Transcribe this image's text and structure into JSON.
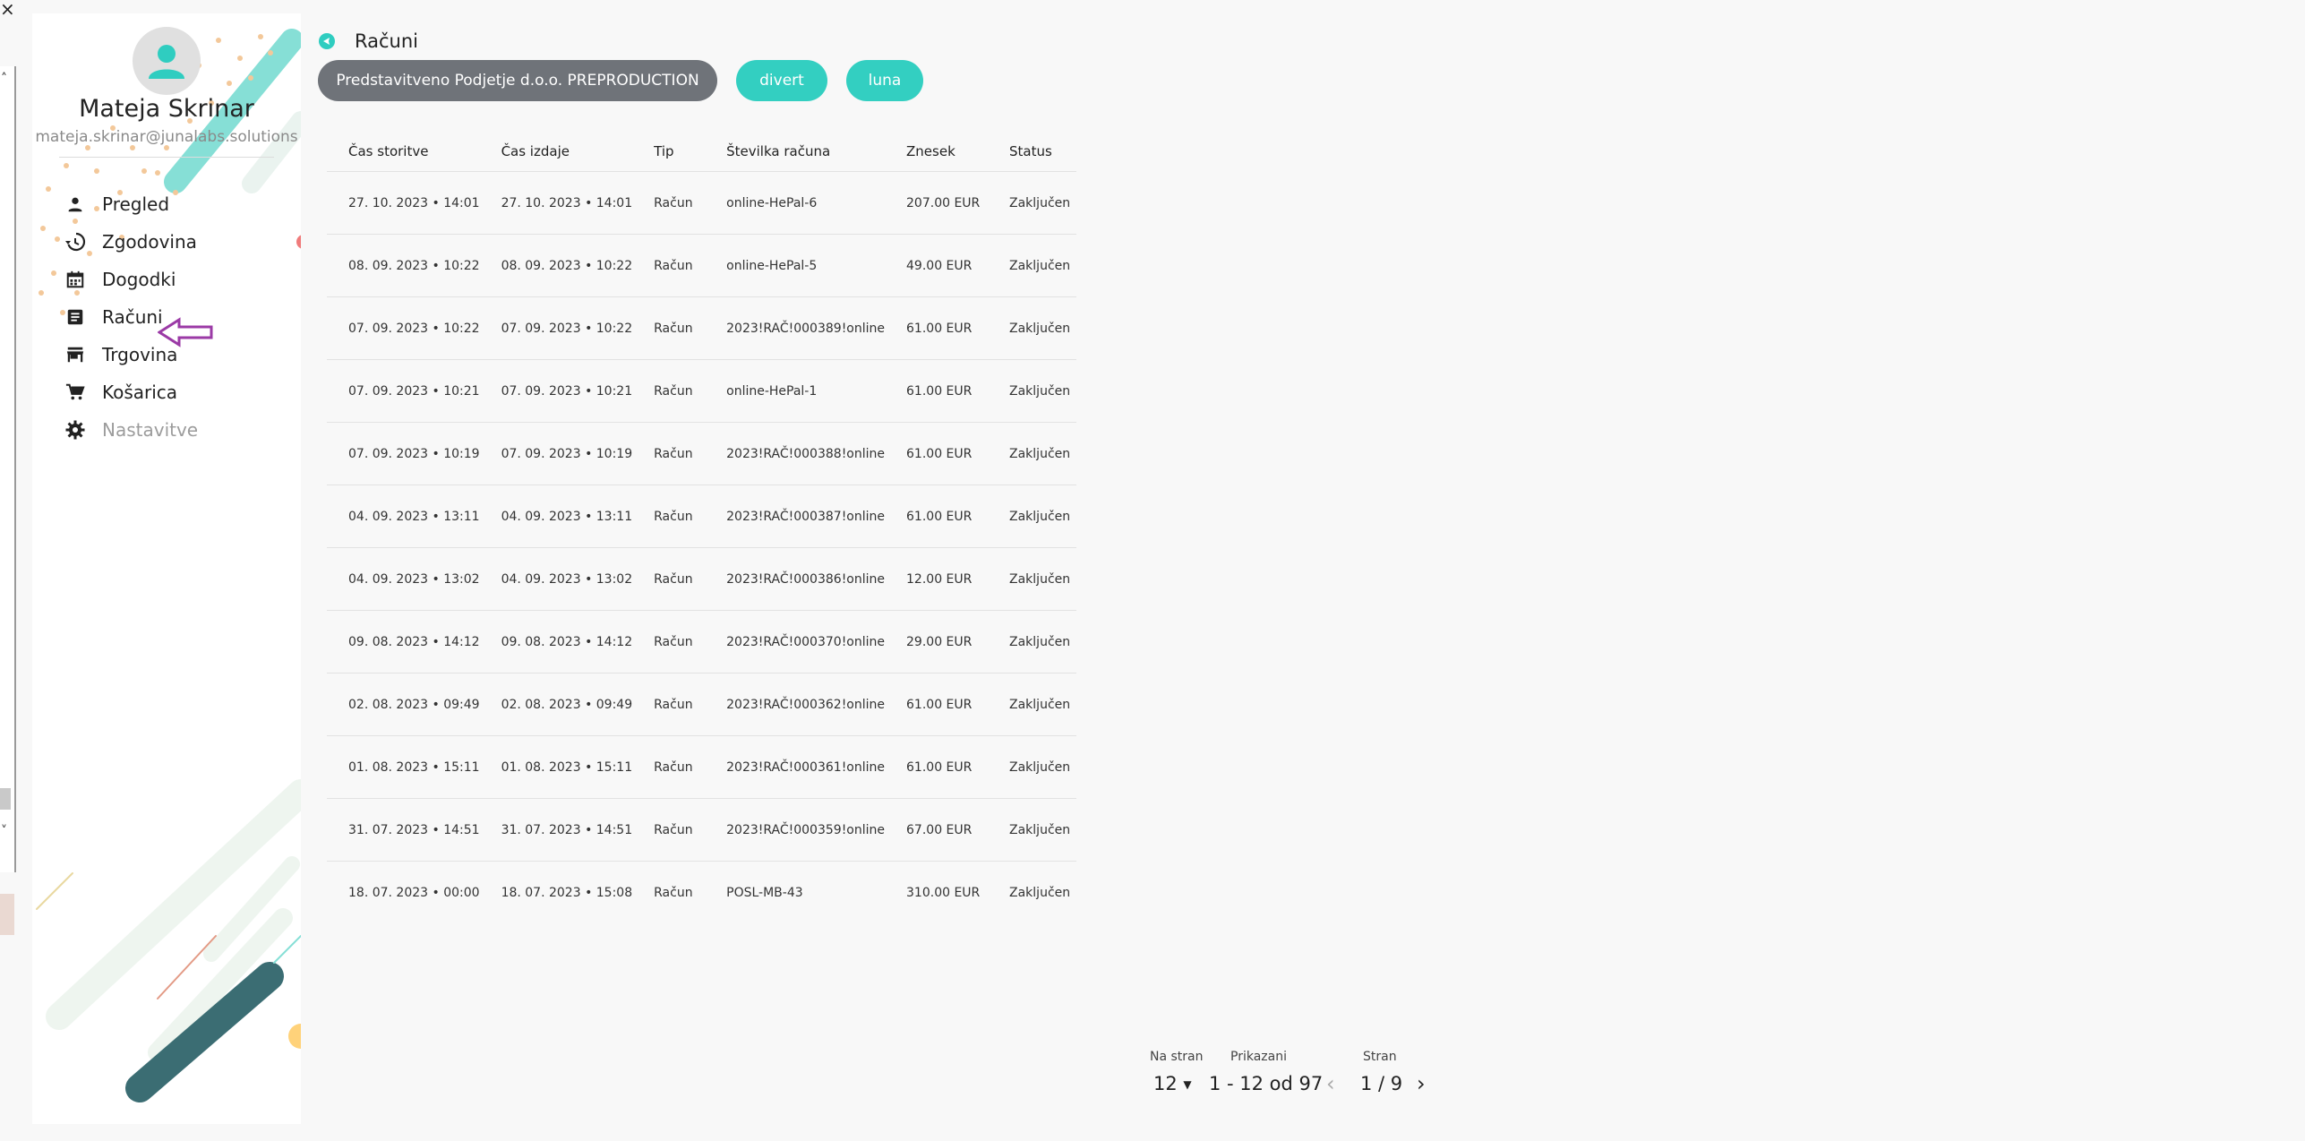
{
  "window": {
    "close_glyph": "×"
  },
  "user": {
    "name": "Mateja Skrinar",
    "email": "mateja.skrinar@junalabs.solutions"
  },
  "nav": {
    "items": [
      {
        "label": "Pregled",
        "icon": "person-icon"
      },
      {
        "label": "Zgodovina",
        "icon": "history-icon"
      },
      {
        "label": "Dogodki",
        "icon": "calendar-icon"
      },
      {
        "label": "Računi",
        "icon": "receipt-icon"
      },
      {
        "label": "Trgovina",
        "icon": "store-icon"
      },
      {
        "label": "Košarica",
        "icon": "cart-icon"
      },
      {
        "label": "Nastavitve",
        "icon": "gear-icon",
        "disabled": true
      }
    ]
  },
  "page": {
    "title": "Računi"
  },
  "filters": {
    "company": "Predstavitveno Podjetje d.o.o. PREPRODUCTION",
    "divert": "divert",
    "luna": "luna"
  },
  "table": {
    "headers": {
      "service_time": "Čas storitve",
      "issue_time": "Čas izdaje",
      "type": "Tip",
      "number": "Številka računa",
      "amount": "Znesek",
      "status": "Status"
    },
    "rows": [
      {
        "service_time": "27. 10. 2023 • 14:01",
        "issue_time": "27. 10. 2023 • 14:01",
        "type": "Račun",
        "number": "online-HePal-6",
        "amount": "207.00 EUR",
        "status": "Zaključen"
      },
      {
        "service_time": "08. 09. 2023 • 10:22",
        "issue_time": "08. 09. 2023 • 10:22",
        "type": "Račun",
        "number": "online-HePal-5",
        "amount": "49.00 EUR",
        "status": "Zaključen"
      },
      {
        "service_time": "07. 09. 2023 • 10:22",
        "issue_time": "07. 09. 2023 • 10:22",
        "type": "Račun",
        "number": "2023!RAČ!000389!online",
        "amount": "61.00 EUR",
        "status": "Zaključen"
      },
      {
        "service_time": "07. 09. 2023 • 10:21",
        "issue_time": "07. 09. 2023 • 10:21",
        "type": "Račun",
        "number": "online-HePal-1",
        "amount": "61.00 EUR",
        "status": "Zaključen"
      },
      {
        "service_time": "07. 09. 2023 • 10:19",
        "issue_time": "07. 09. 2023 • 10:19",
        "type": "Račun",
        "number": "2023!RAČ!000388!online",
        "amount": "61.00 EUR",
        "status": "Zaključen"
      },
      {
        "service_time": "04. 09. 2023 • 13:11",
        "issue_time": "04. 09. 2023 • 13:11",
        "type": "Račun",
        "number": "2023!RAČ!000387!online",
        "amount": "61.00 EUR",
        "status": "Zaključen"
      },
      {
        "service_time": "04. 09. 2023 • 13:02",
        "issue_time": "04. 09. 2023 • 13:02",
        "type": "Račun",
        "number": "2023!RAČ!000386!online",
        "amount": "12.00 EUR",
        "status": "Zaključen"
      },
      {
        "service_time": "09. 08. 2023 • 14:12",
        "issue_time": "09. 08. 2023 • 14:12",
        "type": "Račun",
        "number": "2023!RAČ!000370!online",
        "amount": "29.00 EUR",
        "status": "Zaključen"
      },
      {
        "service_time": "02. 08. 2023 • 09:49",
        "issue_time": "02. 08. 2023 • 09:49",
        "type": "Račun",
        "number": "2023!RAČ!000362!online",
        "amount": "61.00 EUR",
        "status": "Zaključen"
      },
      {
        "service_time": "01. 08. 2023 • 15:11",
        "issue_time": "01. 08. 2023 • 15:11",
        "type": "Račun",
        "number": "2023!RAČ!000361!online",
        "amount": "61.00 EUR",
        "status": "Zaključen"
      },
      {
        "service_time": "31. 07. 2023 • 14:51",
        "issue_time": "31. 07. 2023 • 14:51",
        "type": "Račun",
        "number": "2023!RAČ!000359!online",
        "amount": "67.00 EUR",
        "status": "Zaključen"
      },
      {
        "service_time": "18. 07. 2023 • 00:00",
        "issue_time": "18. 07. 2023 • 15:08",
        "type": "Račun",
        "number": "POSL-MB-43",
        "amount": "310.00 EUR",
        "status": "Zaključen"
      }
    ]
  },
  "pagination": {
    "per_page_label": "Na stran",
    "per_page_value": "12",
    "shown_label": "Prikazani",
    "shown_value": "1 - 12 od 97",
    "page_label": "Stran",
    "page_value": "1 / 9"
  },
  "colors": {
    "accent": "#33cfc1",
    "chip_dark": "#6f7379",
    "arrow": "#9b3aa6",
    "deco_dark": "#3b6d73"
  }
}
